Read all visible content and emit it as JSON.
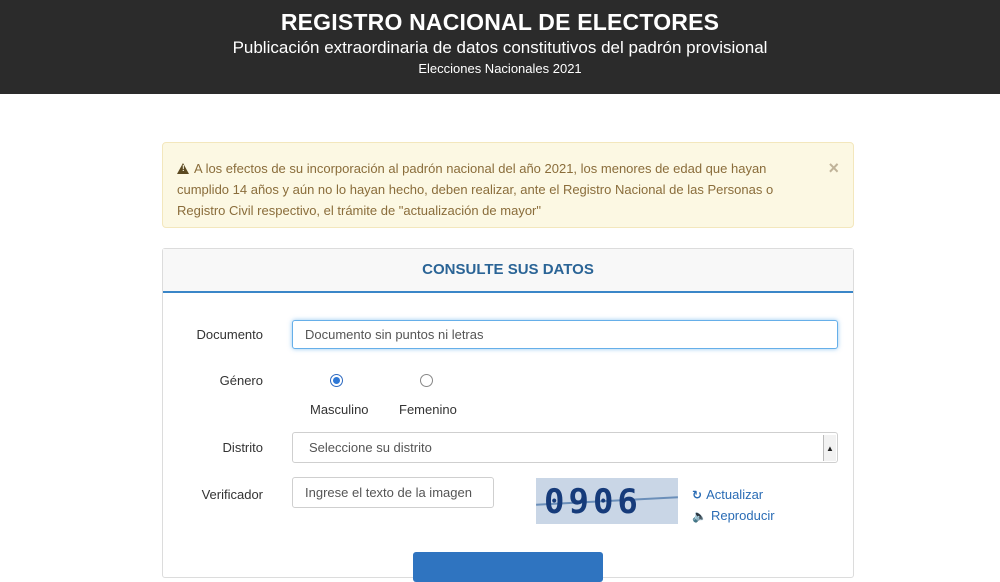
{
  "header": {
    "title": "REGISTRO NACIONAL DE ELECTORES",
    "subtitle": "Publicación extraordinaria de datos constitutivos del padrón provisional",
    "election": "Elecciones Nacionales 2021"
  },
  "alert": {
    "icon": "warning-icon",
    "text": "A los efectos de su incorporación al padrón nacional del año 2021, los menores de edad que hayan cumplido 14 años y aún no lo hayan hecho, deben realizar, ante el Registro Nacional de las Personas o Registro Civil respectivo, el trámite de \"actualización de mayor\"",
    "close": "×",
    "colors": {
      "background": "#fcf8e3",
      "text": "#8a6d3b"
    }
  },
  "form": {
    "heading": "CONSULTE SUS DATOS",
    "documento": {
      "label": "Documento",
      "placeholder": "Documento sin puntos ni letras"
    },
    "genero": {
      "label": "Género",
      "options": [
        "Masculino",
        "Femenino"
      ],
      "selected": "Masculino"
    },
    "distrito": {
      "label": "Distrito",
      "value": "Seleccione su distrito"
    },
    "verificador": {
      "label": "Verificador",
      "placeholder": "Ingrese el texto de la imagen",
      "captcha_text": "0906",
      "refresh_label": "Actualizar",
      "audio_label": "Reproducir"
    }
  },
  "colors": {
    "header_bg": "#2b2b2b",
    "accent": "#2f74c0"
  }
}
